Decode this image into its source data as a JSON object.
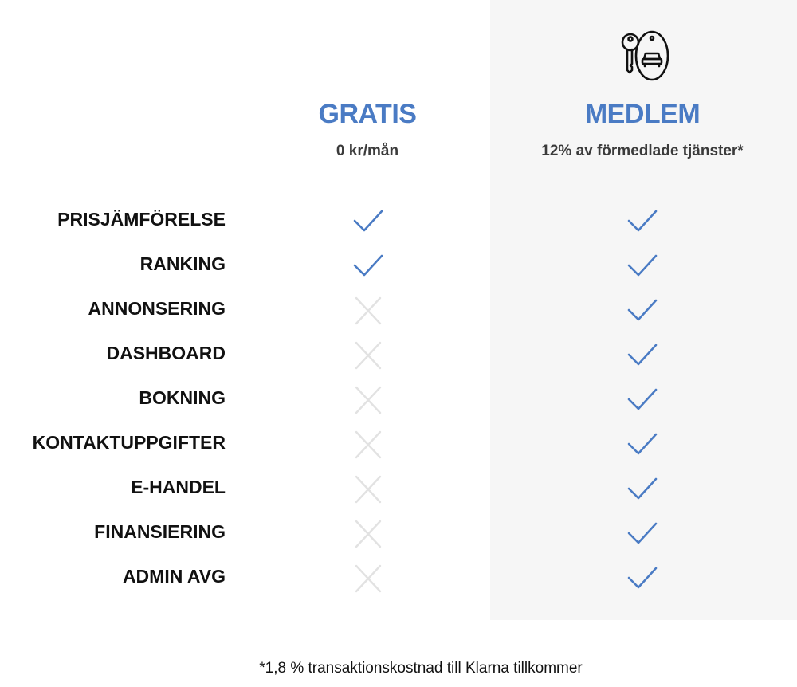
{
  "plans": {
    "free": {
      "title": "GRATIS",
      "price": "0 kr/mån"
    },
    "member": {
      "title": "MEDLEM",
      "price": "12% av förmedlade tjänster*",
      "icon": "car-key-icon"
    }
  },
  "features": [
    {
      "label": "PRISJÄMFÖRELSE",
      "free": true,
      "member": true
    },
    {
      "label": "RANKING",
      "free": true,
      "member": true
    },
    {
      "label": "ANNONSERING",
      "free": false,
      "member": true
    },
    {
      "label": "DASHBOARD",
      "free": false,
      "member": true
    },
    {
      "label": "BOKNING",
      "free": false,
      "member": true
    },
    {
      "label": "KONTAKTUPPGIFTER",
      "free": false,
      "member": true
    },
    {
      "label": "E-HANDEL",
      "free": false,
      "member": true
    },
    {
      "label": "FINANSIERING",
      "free": false,
      "member": true
    },
    {
      "label": "ADMIN AVG",
      "free": false,
      "member": true
    }
  ],
  "footnote": "*1,8 % transaktionskostnad till Klarna tillkommer",
  "colors": {
    "accent": "#4a7bc4",
    "cross": "#e2e2e2",
    "panel": "#f6f6f6"
  }
}
